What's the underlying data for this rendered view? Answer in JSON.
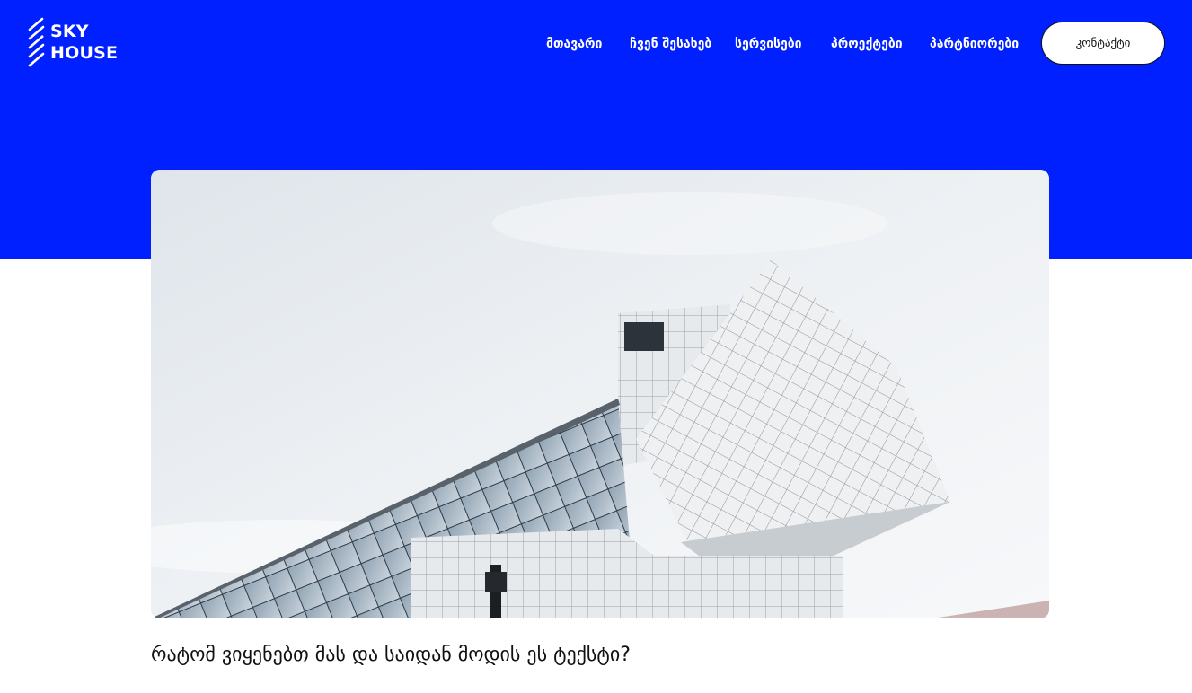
{
  "brand": {
    "line1": "SKY",
    "line2": "HOUSE"
  },
  "nav": {
    "items": [
      {
        "label": "მთავარი"
      },
      {
        "label": "ჩვენ შესახებ"
      },
      {
        "label": "სერვისები"
      },
      {
        "label": "პროექტები"
      },
      {
        "label": "პარტნიორები"
      }
    ],
    "contact_label": "კონტაქტი"
  },
  "article": {
    "title": "რატომ ვიყენებთ მას და საიდან მოდის ეს ტექსტი?"
  },
  "colors": {
    "header_blue": "#0020ff",
    "text": "#111111",
    "button_bg": "#ffffff"
  }
}
